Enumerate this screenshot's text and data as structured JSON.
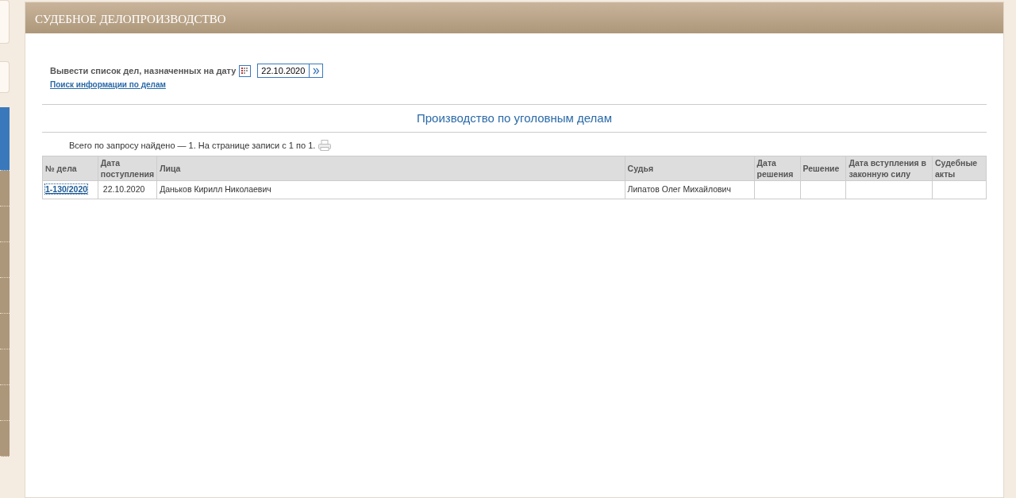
{
  "sidebar": {
    "items": [
      {
        "kind": "box"
      },
      {
        "kind": "box"
      },
      {
        "kind": "tab",
        "selected": true
      },
      {
        "kind": "tab",
        "selected": false
      },
      {
        "kind": "tab",
        "selected": false
      },
      {
        "kind": "tab",
        "selected": false
      },
      {
        "kind": "tab",
        "selected": false
      },
      {
        "kind": "tab",
        "selected": false
      },
      {
        "kind": "tab",
        "selected": false
      },
      {
        "kind": "tab",
        "selected": false
      },
      {
        "kind": "tab",
        "selected": false
      }
    ]
  },
  "panel": {
    "title": "СУДЕБНОЕ ДЕЛОПРОИЗВОДСТВО",
    "date_filter": {
      "label": "Вывести список дел, назначенных на дату",
      "value": "22.10.2020"
    },
    "search_link": "Поиск информации по делам",
    "section_title": "Производство по уголовным делам",
    "summary": "Всего по запросу найдено — 1. На странице записи с 1 по 1.",
    "table": {
      "columns": [
        "№ дела",
        "Дата поступления",
        "Лица",
        "Судья",
        "Дата решения",
        "Решение",
        "Дата вступления в законную силу",
        "Судебные акты"
      ],
      "rows": [
        [
          "1-130/2020",
          "22.10.2020",
          "Даньков Кирилл Николаевич",
          "Липатов Олег Михайлович",
          "",
          "",
          "",
          ""
        ]
      ]
    }
  }
}
